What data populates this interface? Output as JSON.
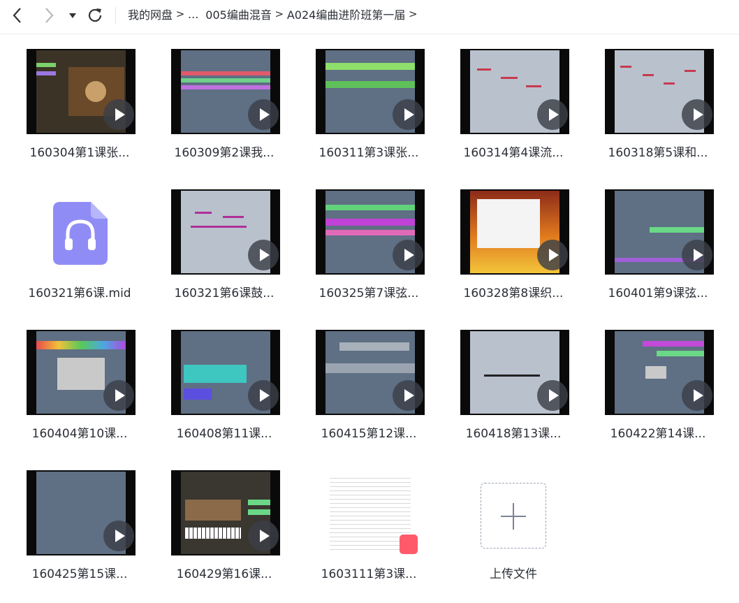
{
  "breadcrumb": {
    "items": [
      "我的网盘",
      "...",
      "005编曲混音",
      "A024编曲进阶班第一届"
    ]
  },
  "colors": {
    "accent": "#5b6cff",
    "play_overlay": "#3c4048",
    "pdf_badge": "#ff5a6a"
  },
  "files": [
    {
      "name": "160304第1课张...",
      "type": "video",
      "icon": "play-icon"
    },
    {
      "name": "160309第2课我...",
      "type": "video",
      "icon": "play-icon"
    },
    {
      "name": "160311第3课张...",
      "type": "video",
      "icon": "play-icon"
    },
    {
      "name": "160314第4课流...",
      "type": "video",
      "icon": "play-icon"
    },
    {
      "name": "160318第5课和...",
      "type": "video",
      "icon": "play-icon"
    },
    {
      "name": "160321第6课.mid",
      "type": "audio",
      "icon": "headphones-icon"
    },
    {
      "name": "160321第6课鼓...",
      "type": "video",
      "icon": "play-icon"
    },
    {
      "name": "160325第7课弦...",
      "type": "video",
      "icon": "play-icon"
    },
    {
      "name": "160328第8课织...",
      "type": "video",
      "icon": "play-icon"
    },
    {
      "name": "160401第9课弦...",
      "type": "video",
      "icon": "play-icon"
    },
    {
      "name": "160404第10课...",
      "type": "video",
      "icon": "play-icon"
    },
    {
      "name": "160408第11课...",
      "type": "video",
      "icon": "play-icon"
    },
    {
      "name": "160415第12课...",
      "type": "video",
      "icon": "play-icon"
    },
    {
      "name": "160418第13课...",
      "type": "video",
      "icon": "play-icon"
    },
    {
      "name": "160422第14课...",
      "type": "video",
      "icon": "play-icon"
    },
    {
      "name": "160425第15课...",
      "type": "video",
      "icon": "play-icon"
    },
    {
      "name": "160429第16课...",
      "type": "video",
      "icon": "play-icon"
    },
    {
      "name": "1603111第3课...",
      "type": "pdf",
      "icon": "pdf-icon"
    }
  ],
  "upload": {
    "label": "上传文件",
    "icon": "plus-icon"
  }
}
